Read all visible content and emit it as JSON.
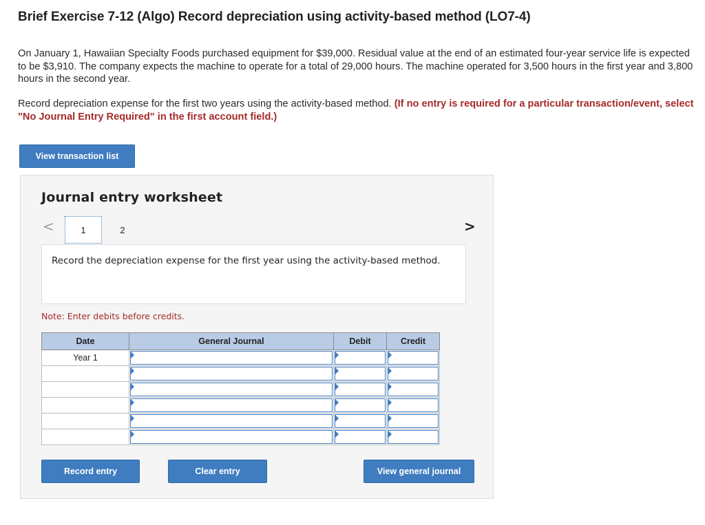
{
  "header": {
    "title": "Brief Exercise 7-12 (Algo) Record depreciation using activity-based method (LO7-4)"
  },
  "problem": {
    "paragraph1": "On January 1, Hawaiian Specialty Foods purchased equipment for $39,000. Residual value at the end of an estimated four-year service life is expected to be $3,910. The company expects the machine to operate for a total of 29,000 hours. The machine operated for 3,500 hours in the first year and 3,800 hours in the second year.",
    "paragraph2_plain": "Record depreciation expense for the first two years using the activity-based method.",
    "paragraph2_red": "(If no entry is required for a particular transaction/event, select \"No Journal Entry Required\" in the first account field.)"
  },
  "buttons": {
    "view_transaction_list": "View transaction list",
    "record_entry": "Record entry",
    "clear_entry": "Clear entry",
    "view_general_journal": "View general journal"
  },
  "worksheet": {
    "title": "Journal entry worksheet",
    "prev_arrow": "<",
    "next_arrow": ">",
    "tabs": [
      "1",
      "2"
    ],
    "selected_tab": "1",
    "instruction": "Record the depreciation expense for the first year using the activity-based method.",
    "note": "Note: Enter debits before credits.",
    "table": {
      "headers": [
        "Date",
        "General Journal",
        "Debit",
        "Credit"
      ],
      "rows": [
        {
          "date": "Year 1",
          "journal": "",
          "debit": "",
          "credit": ""
        },
        {
          "date": "",
          "journal": "",
          "debit": "",
          "credit": ""
        },
        {
          "date": "",
          "journal": "",
          "debit": "",
          "credit": ""
        },
        {
          "date": "",
          "journal": "",
          "debit": "",
          "credit": ""
        },
        {
          "date": "",
          "journal": "",
          "debit": "",
          "credit": ""
        },
        {
          "date": "",
          "journal": "",
          "debit": "",
          "credit": ""
        }
      ]
    }
  },
  "colors": {
    "accent_blue": "#3f7dc0",
    "header_blue": "#b9cbe5",
    "red_text": "#a52a2a"
  }
}
